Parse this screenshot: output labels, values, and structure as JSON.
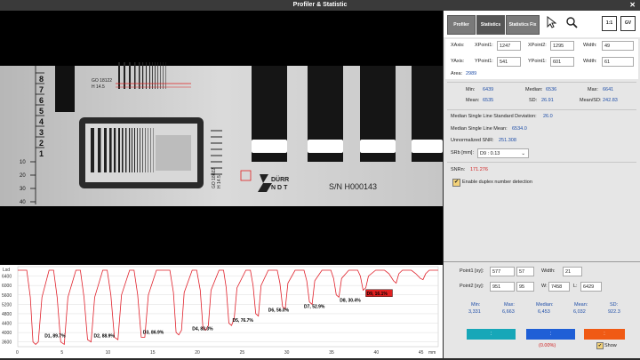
{
  "window": {
    "title": "Profiler & Statistic",
    "close_glyph": "✕"
  },
  "tabs": [
    "Profiler",
    "Statistics",
    "Statistics Fix"
  ],
  "tools": {
    "select": "pointer-icon",
    "zoom": "magnifier-icon",
    "one_to_one": "1:1",
    "gv": "GV"
  },
  "image": {
    "serial": "S/N H000143",
    "brand1": "DÜRR",
    "brand2": "NDT",
    "code": "GO 18122",
    "h": "H 14.5",
    "code2": "GO 18022",
    "h2": "H 14.5",
    "ruler_top": [
      "8",
      "7",
      "6",
      "5",
      "4",
      "3",
      "2",
      "1"
    ],
    "ruler_bottom": [
      "10",
      "20",
      "30",
      "40"
    ]
  },
  "roi": {
    "xaxis_label": "XAxis:",
    "xpoint1_label": "XPoint1:",
    "xpoint1": "1247",
    "xpoint2_label": "XPoint2:",
    "xpoint2": "1295",
    "width_label": "Width:",
    "width_x": "49",
    "yaxis_label": "YAxis:",
    "ypoint1_label": "YPoint1:",
    "ypoint1": "541",
    "ypoint2_label": "YPoint2:",
    "ypoint2": "601",
    "width_y": "61",
    "area_label": "Area:",
    "area": "2989"
  },
  "stats": {
    "min_label": "Min:",
    "min": "6439",
    "median_label": "Median:",
    "median": "6536",
    "max_label": "Max:",
    "max": "6641",
    "mean_label": "Mean:",
    "mean": "6535",
    "sd_label": "SD:",
    "sd": "26.91",
    "meansd_label": "Mean/SD:",
    "meansd": "242.83"
  },
  "snr": {
    "msl_sd_label": "Median Single Line Standard Deviation:",
    "msl_sd": "26.0",
    "msl_mean_label": "Median Single Line Mean:",
    "msl_mean": "6534.0",
    "unnorm_label": "Unnormalized SNR:",
    "unnorm": "251.308",
    "srb_label": "SRb [mm]:",
    "srb_value": "D9 : 0.13",
    "snrn_label": "SNRn:",
    "snrn": "171.276",
    "duplex_label": "Enable duplex number detection",
    "duplex_checked": "✔"
  },
  "profile": {
    "p1_label": "Point1 [xy]:",
    "p1x": "577",
    "p1y": "57",
    "width_label": "Width:",
    "width": "21",
    "p2_label": "Point2 [xy]:",
    "p2x": "951",
    "p2y": "95",
    "w_label": "W:",
    "w": "7458",
    "l_label": "L:",
    "l": "6429",
    "min_label": "Min:",
    "min": "3,331",
    "max_label": "Max:",
    "max": "6,663",
    "median_label": "Median:",
    "median": "6,453",
    "mean_label": "Mean:",
    "mean": "6,032",
    "sd_label": "SD:",
    "sd": "922.3",
    "btn1": ":",
    "btn2": ":",
    "btn3": ":",
    "pct": "(0.00%)",
    "show_label": "Show",
    "show_checked": "✔",
    "colors": {
      "cyan": "#17a7b8",
      "blue": "#1f5fd6",
      "orange": "#f05a14"
    }
  },
  "chart_data": {
    "type": "line",
    "ylabel": "Lsd",
    "xlabel": "mm",
    "xlim": [
      0,
      47
    ],
    "ylim": [
      3400,
      6800
    ],
    "x_ticks": [
      0,
      5,
      10,
      15,
      20,
      25,
      30,
      35,
      40,
      45
    ],
    "y_ticks": [
      3600,
      4000,
      4400,
      4800,
      5200,
      5600,
      6000,
      6400
    ],
    "series": [
      {
        "color": "#e0202a",
        "x": [
          0,
          1,
          1.4,
          1.7,
          2.0,
          2.3,
          2.7,
          3.5,
          4.0,
          4.4,
          4.8,
          5.2,
          5.6,
          6.5,
          7.0,
          7.4,
          7.8,
          8.2,
          8.6,
          9.5,
          10.0,
          10.4,
          10.8,
          11.2,
          11.6,
          12.5,
          13.0,
          13.4,
          13.8,
          14.2,
          14.6,
          15.5,
          16,
          17,
          17.4,
          17.7,
          18.0,
          18.3,
          18.6,
          19.5,
          20,
          20.4,
          20.7,
          21.0,
          21.3,
          21.6,
          22.5,
          23,
          23.3,
          23.6,
          23.9,
          24.2,
          24.5,
          25.5,
          26,
          26.3,
          26.6,
          26.9,
          27.2,
          28,
          29,
          29.3,
          29.6,
          29.9,
          30.2,
          31,
          32,
          32.3,
          32.6,
          32.9,
          33.2,
          34,
          35,
          35.3,
          35.6,
          35.9,
          36.2,
          37,
          38,
          38.3,
          38.6,
          38.9,
          39.2,
          40,
          41,
          41.5,
          42,
          42.3,
          42.6,
          43,
          44,
          44.5,
          45,
          45.3,
          45.6,
          46,
          47
        ],
        "values": [
          6650,
          6650,
          5500,
          3600,
          3500,
          3600,
          5500,
          6650,
          6650,
          5500,
          3600,
          3500,
          5500,
          6650,
          6650,
          5500,
          3700,
          3600,
          5500,
          6650,
          6650,
          5600,
          3800,
          3700,
          5600,
          6650,
          6650,
          5600,
          3800,
          3800,
          5600,
          6650,
          6650,
          6650,
          5700,
          4000,
          3900,
          4100,
          5700,
          6650,
          6650,
          5800,
          4200,
          4100,
          4300,
          5800,
          6650,
          6650,
          5900,
          4400,
          4300,
          4600,
          5900,
          6650,
          6650,
          6000,
          4800,
          4700,
          6000,
          6650,
          6650,
          6100,
          5100,
          5000,
          6100,
          6650,
          6650,
          6200,
          5300,
          5200,
          6200,
          6650,
          6650,
          6300,
          5600,
          5500,
          6300,
          6650,
          6650,
          6400,
          5800,
          5900,
          6400,
          6650,
          6650,
          6500,
          6200,
          6100,
          6500,
          6650,
          6650,
          6500,
          6300,
          6250,
          6500,
          6650,
          6650
        ]
      }
    ],
    "annotations": [
      {
        "label": "D1, 89.7%",
        "x": 3.0,
        "y": 3800
      },
      {
        "label": "D2, 88.9%",
        "x": 8.5,
        "y": 3800
      },
      {
        "label": "D3, 86.9%",
        "x": 14.0,
        "y": 3950
      },
      {
        "label": "D4, 83.3%",
        "x": 19.5,
        "y": 4100
      },
      {
        "label": "D5, 76.7%",
        "x": 24.0,
        "y": 4450
      },
      {
        "label": "D6, 56.0%",
        "x": 28.0,
        "y": 4900
      },
      {
        "label": "D7, 52.9%",
        "x": 32.0,
        "y": 5050
      },
      {
        "label": "D8, 30.4%",
        "x": 36.0,
        "y": 5300
      },
      {
        "label": "D9, 16.1%",
        "x": 39.0,
        "y": 5600,
        "highlight": true
      }
    ]
  }
}
